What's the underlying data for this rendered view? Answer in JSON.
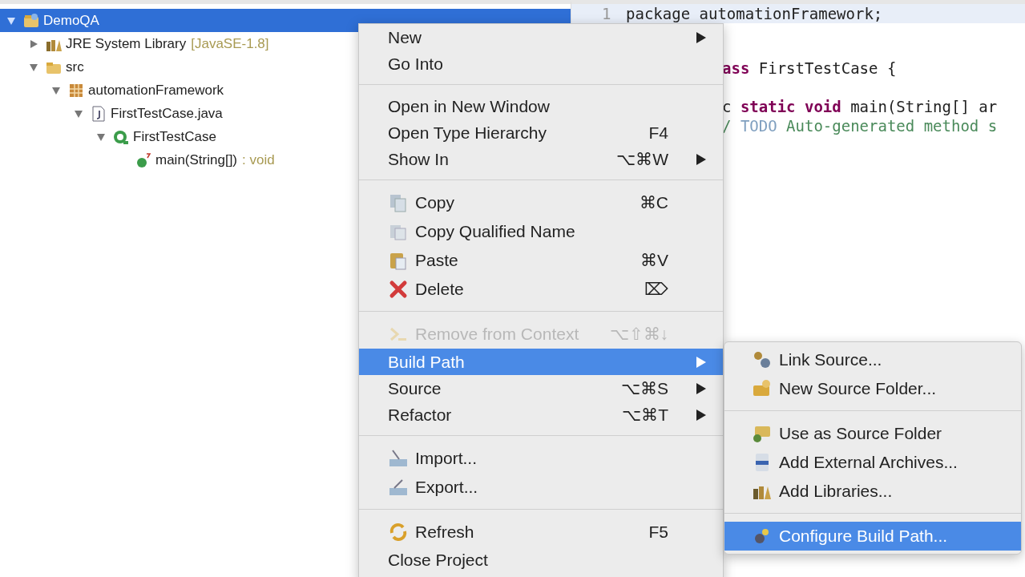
{
  "project_tree": [
    {
      "label": "DemoQA",
      "selected": true,
      "expanded": true,
      "children": [
        {
          "label": "JRE System Library",
          "decoration": "[JavaSE-1.8]",
          "selected": false,
          "expanded": false
        },
        {
          "label": "src",
          "selected": false,
          "expanded": true,
          "children": [
            {
              "label": "automationFramework",
              "selected": false,
              "expanded": true,
              "children": [
                {
                  "label": "FirstTestCase.java",
                  "selected": false,
                  "expanded": true,
                  "children": [
                    {
                      "label": "FirstTestCase",
                      "selected": false,
                      "expanded": true,
                      "children": [
                        {
                          "label": "main(String[])",
                          "decoration": ": void",
                          "selected": false
                        }
                      ]
                    }
                  ]
                }
              ]
            }
          ]
        }
      ]
    }
  ],
  "editor": {
    "lines": [
      {
        "kind": "text",
        "number": "1",
        "code": [
          {
            "kind": "plain",
            "text": "package automationFramework;"
          }
        ],
        "current": true
      },
      {
        "kind": "blank"
      },
      {
        "kind": "text",
        "code": [
          {
            "kind": "keyword",
            "text": "ass"
          },
          {
            "kind": "plain",
            "text": " FirstTestCase {"
          }
        ],
        "current": false
      },
      {
        "kind": "blank"
      },
      {
        "kind": "text",
        "code": [
          {
            "kind": "plain",
            "text": "c "
          },
          {
            "kind": "keyword",
            "text": "static void"
          },
          {
            "kind": "plain",
            "text": " main(String[] ar"
          }
        ],
        "current": false
      },
      {
        "kind": "text",
        "code": [
          {
            "kind": "comment",
            "text": "/ "
          },
          {
            "kind": "todo",
            "text": "TODO"
          },
          {
            "kind": "comment",
            "text": " Auto-generated method s"
          }
        ],
        "current": false
      }
    ]
  },
  "context_menu": [
    {
      "kind": "item",
      "label": "New",
      "submenu": true,
      "selected": false,
      "disabled": false
    },
    {
      "kind": "item",
      "label": "Go Into",
      "submenu": false,
      "selected": false,
      "disabled": false
    },
    {
      "kind": "separator"
    },
    {
      "kind": "item",
      "label": "Open in New Window",
      "submenu": false,
      "selected": false,
      "disabled": false
    },
    {
      "kind": "item",
      "label": "Open Type Hierarchy",
      "shortcut": "F4",
      "submenu": false,
      "selected": false,
      "disabled": false
    },
    {
      "kind": "item",
      "label": "Show In",
      "shortcut": "⌥⌘W",
      "submenu": true,
      "selected": false,
      "disabled": false
    },
    {
      "kind": "separator"
    },
    {
      "kind": "item",
      "label": "Copy",
      "shortcut": "⌘C",
      "submenu": false,
      "selected": false,
      "disabled": false
    },
    {
      "kind": "item",
      "label": "Copy Qualified Name",
      "submenu": false,
      "selected": false,
      "disabled": false
    },
    {
      "kind": "item",
      "label": "Paste",
      "shortcut": "⌘V",
      "submenu": false,
      "selected": false,
      "disabled": false
    },
    {
      "kind": "item",
      "label": "Delete",
      "shortcut": "⌦",
      "submenu": false,
      "selected": false,
      "disabled": false
    },
    {
      "kind": "separator"
    },
    {
      "kind": "item",
      "label": "Remove from Context",
      "shortcut": "⌥⇧⌘↓",
      "submenu": false,
      "selected": false,
      "disabled": true
    },
    {
      "kind": "item",
      "label": "Build Path",
      "submenu": true,
      "selected": true,
      "disabled": false
    },
    {
      "kind": "item",
      "label": "Source",
      "shortcut": "⌥⌘S",
      "submenu": true,
      "selected": false,
      "disabled": false
    },
    {
      "kind": "item",
      "label": "Refactor",
      "shortcut": "⌥⌘T",
      "submenu": true,
      "selected": false,
      "disabled": false
    },
    {
      "kind": "separator"
    },
    {
      "kind": "item",
      "label": "Import...",
      "submenu": false,
      "selected": false,
      "disabled": false
    },
    {
      "kind": "item",
      "label": "Export...",
      "submenu": false,
      "selected": false,
      "disabled": false
    },
    {
      "kind": "separator"
    },
    {
      "kind": "item",
      "label": "Refresh",
      "shortcut": "F5",
      "submenu": false,
      "selected": false,
      "disabled": false
    },
    {
      "kind": "item",
      "label": "Close Project",
      "submenu": false,
      "selected": false,
      "disabled": false
    }
  ],
  "build_path_submenu": [
    {
      "kind": "item",
      "label": "Link Source...",
      "selected": false
    },
    {
      "kind": "item",
      "label": "New Source Folder...",
      "selected": false
    },
    {
      "kind": "separator"
    },
    {
      "kind": "item",
      "label": "Use as Source Folder",
      "selected": false
    },
    {
      "kind": "item",
      "label": "Add External Archives...",
      "selected": false
    },
    {
      "kind": "item",
      "label": "Add Libraries...",
      "selected": false
    },
    {
      "kind": "separator"
    },
    {
      "kind": "item",
      "label": "Configure Build Path...",
      "selected": true
    }
  ]
}
